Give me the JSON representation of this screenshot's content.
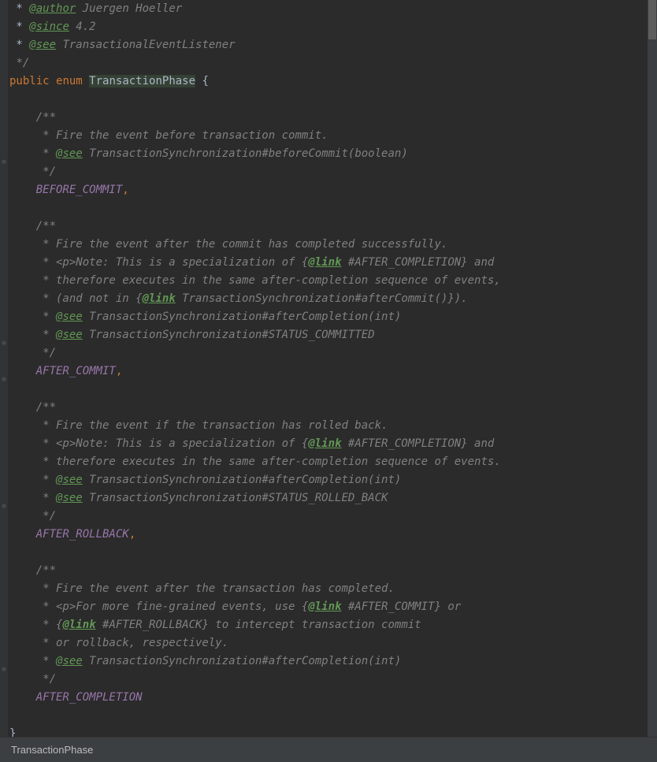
{
  "breadcrumb": "TransactionPhase",
  "lines": [
    {
      "indent": " * ",
      "segments": [
        {
          "t": "doc-tag",
          "v": "@author"
        },
        {
          "t": "comment",
          "v": " Juergen Hoeller"
        }
      ]
    },
    {
      "indent": " * ",
      "segments": [
        {
          "t": "doc-tag",
          "v": "@since"
        },
        {
          "t": "comment",
          "v": " 4.2"
        }
      ]
    },
    {
      "indent": " * ",
      "segments": [
        {
          "t": "doc-tag",
          "v": "@see"
        },
        {
          "t": "doc-ref",
          "v": " TransactionalEventListener"
        }
      ]
    },
    {
      "indent": " ",
      "segments": [
        {
          "t": "comment",
          "v": "*/"
        }
      ]
    },
    {
      "indent": "",
      "segments": [
        {
          "t": "keyword",
          "v": "public "
        },
        {
          "t": "keyword",
          "v": "enum "
        },
        {
          "t": "enum-name",
          "v": "TransactionPhase"
        },
        {
          "t": "brace",
          "v": " {"
        }
      ]
    },
    {
      "indent": "",
      "segments": []
    },
    {
      "indent": "    ",
      "segments": [
        {
          "t": "comment",
          "v": "/**"
        }
      ]
    },
    {
      "indent": "    ",
      "segments": [
        {
          "t": "comment",
          "v": " * Fire the event before transaction commit."
        }
      ]
    },
    {
      "indent": "    ",
      "segments": [
        {
          "t": "comment",
          "v": " * "
        },
        {
          "t": "doc-tag",
          "v": "@see"
        },
        {
          "t": "doc-ref",
          "v": " TransactionSynchronization"
        },
        {
          "t": "doc-anchor",
          "v": "#beforeCommit(boolean)"
        }
      ]
    },
    {
      "indent": "    ",
      "segments": [
        {
          "t": "comment",
          "v": " */"
        }
      ]
    },
    {
      "indent": "    ",
      "segments": [
        {
          "t": "enum-value",
          "v": "BEFORE_COMMIT"
        },
        {
          "t": "punct",
          "v": ","
        }
      ]
    },
    {
      "indent": "",
      "segments": []
    },
    {
      "indent": "    ",
      "segments": [
        {
          "t": "comment",
          "v": "/**"
        }
      ]
    },
    {
      "indent": "    ",
      "segments": [
        {
          "t": "comment",
          "v": " * Fire the event after the commit has completed successfully."
        }
      ]
    },
    {
      "indent": "    ",
      "segments": [
        {
          "t": "comment",
          "v": " * <p>Note: This is a specialization of {"
        },
        {
          "t": "doc-link",
          "v": "@link"
        },
        {
          "t": "comment",
          "v": " #AFTER_COMPLETION} and"
        }
      ]
    },
    {
      "indent": "    ",
      "segments": [
        {
          "t": "comment",
          "v": " * therefore executes in the same after-completion sequence of events,"
        }
      ]
    },
    {
      "indent": "    ",
      "segments": [
        {
          "t": "comment",
          "v": " * (and not in {"
        },
        {
          "t": "doc-link",
          "v": "@link"
        },
        {
          "t": "doc-ref",
          "v": " TransactionSynchronization"
        },
        {
          "t": "doc-anchor",
          "v": "#afterCommit()"
        },
        {
          "t": "comment",
          "v": "})."
        }
      ]
    },
    {
      "indent": "    ",
      "segments": [
        {
          "t": "comment",
          "v": " * "
        },
        {
          "t": "doc-tag",
          "v": "@see"
        },
        {
          "t": "doc-ref",
          "v": " TransactionSynchronization"
        },
        {
          "t": "doc-anchor",
          "v": "#afterCompletion(int)"
        }
      ]
    },
    {
      "indent": "    ",
      "segments": [
        {
          "t": "comment",
          "v": " * "
        },
        {
          "t": "doc-tag",
          "v": "@see"
        },
        {
          "t": "doc-ref",
          "v": " TransactionSynchronization"
        },
        {
          "t": "doc-anchor",
          "v": "#STATUS_COMMITTED"
        }
      ]
    },
    {
      "indent": "    ",
      "segments": [
        {
          "t": "comment",
          "v": " */"
        }
      ]
    },
    {
      "indent": "    ",
      "segments": [
        {
          "t": "enum-value",
          "v": "AFTER_COMMIT"
        },
        {
          "t": "punct",
          "v": ","
        }
      ]
    },
    {
      "indent": "",
      "segments": []
    },
    {
      "indent": "    ",
      "segments": [
        {
          "t": "comment",
          "v": "/**"
        }
      ]
    },
    {
      "indent": "    ",
      "segments": [
        {
          "t": "comment",
          "v": " * Fire the event if the transaction has rolled back."
        }
      ]
    },
    {
      "indent": "    ",
      "segments": [
        {
          "t": "comment",
          "v": " * <p>Note: This is a specialization of {"
        },
        {
          "t": "doc-link",
          "v": "@link"
        },
        {
          "t": "comment",
          "v": " #AFTER_COMPLETION} and"
        }
      ]
    },
    {
      "indent": "    ",
      "segments": [
        {
          "t": "comment",
          "v": " * therefore executes in the same after-completion sequence of events."
        }
      ]
    },
    {
      "indent": "    ",
      "segments": [
        {
          "t": "comment",
          "v": " * "
        },
        {
          "t": "doc-tag",
          "v": "@see"
        },
        {
          "t": "doc-ref",
          "v": " TransactionSynchronization"
        },
        {
          "t": "doc-anchor",
          "v": "#afterCompletion(int)"
        }
      ]
    },
    {
      "indent": "    ",
      "segments": [
        {
          "t": "comment",
          "v": " * "
        },
        {
          "t": "doc-tag",
          "v": "@see"
        },
        {
          "t": "doc-ref",
          "v": " TransactionSynchronization"
        },
        {
          "t": "doc-anchor",
          "v": "#STATUS_ROLLED_BACK"
        }
      ]
    },
    {
      "indent": "    ",
      "segments": [
        {
          "t": "comment",
          "v": " */"
        }
      ]
    },
    {
      "indent": "    ",
      "segments": [
        {
          "t": "enum-value",
          "v": "AFTER_ROLLBACK"
        },
        {
          "t": "punct",
          "v": ","
        }
      ]
    },
    {
      "indent": "",
      "segments": []
    },
    {
      "indent": "    ",
      "segments": [
        {
          "t": "comment",
          "v": "/**"
        }
      ]
    },
    {
      "indent": "    ",
      "segments": [
        {
          "t": "comment",
          "v": " * Fire the event after the transaction has completed."
        }
      ]
    },
    {
      "indent": "    ",
      "segments": [
        {
          "t": "comment",
          "v": " * <p>For more fine-grained events, use {"
        },
        {
          "t": "doc-link",
          "v": "@link"
        },
        {
          "t": "comment",
          "v": " #AFTER_COMMIT} or"
        }
      ]
    },
    {
      "indent": "    ",
      "segments": [
        {
          "t": "comment",
          "v": " * {"
        },
        {
          "t": "doc-link",
          "v": "@link"
        },
        {
          "t": "comment",
          "v": " #AFTER_ROLLBACK} to intercept transaction commit"
        }
      ]
    },
    {
      "indent": "    ",
      "segments": [
        {
          "t": "comment",
          "v": " * or rollback, respectively."
        }
      ]
    },
    {
      "indent": "    ",
      "segments": [
        {
          "t": "comment",
          "v": " * "
        },
        {
          "t": "doc-tag",
          "v": "@see"
        },
        {
          "t": "doc-ref",
          "v": " TransactionSynchronization"
        },
        {
          "t": "doc-anchor",
          "v": "#afterCompletion(int)"
        }
      ]
    },
    {
      "indent": "    ",
      "segments": [
        {
          "t": "comment",
          "v": " */"
        }
      ]
    },
    {
      "indent": "    ",
      "segments": [
        {
          "t": "enum-value",
          "v": "AFTER_COMPLETION"
        }
      ]
    },
    {
      "indent": "",
      "segments": []
    },
    {
      "indent": "",
      "segments": [
        {
          "t": "brace",
          "v": "}"
        }
      ]
    }
  ],
  "gutterMarkers": [
    {
      "line": 9,
      "icon": "⊖"
    },
    {
      "line": 19,
      "icon": "⊖"
    },
    {
      "line": 21,
      "icon": "⊖"
    },
    {
      "line": 28,
      "icon": "⊖"
    },
    {
      "line": 37,
      "icon": "⊖"
    }
  ]
}
